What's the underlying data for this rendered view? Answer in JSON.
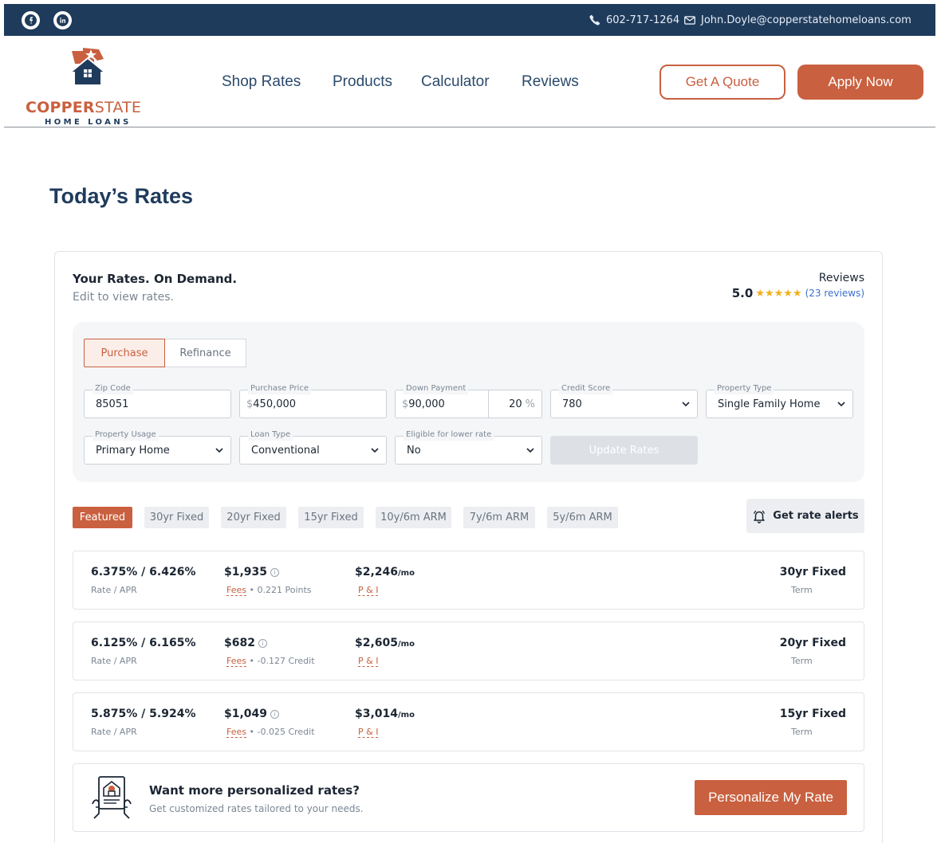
{
  "topbar": {
    "social": [
      {
        "icon": "facebook-icon"
      },
      {
        "icon": "linkedin-icon"
      }
    ],
    "phone": "602-717-1264",
    "email": "John.Doyle@copperstatehomeloans.com"
  },
  "logo": {
    "word_a": "COPPER",
    "word_b": "STATE",
    "sub": "HOME LOANS"
  },
  "nav": {
    "items": [
      "Shop Rates",
      "Products",
      "Calculator",
      "Reviews"
    ],
    "quote_label": "Get A Quote",
    "apply_label": "Apply Now"
  },
  "page": {
    "title": "Today’s Rates"
  },
  "card": {
    "title": "Your Rates. On Demand.",
    "subtitle": "Edit to view rates.",
    "reviews_label": "Reviews",
    "score": "5.0",
    "stars": "★★★★★",
    "reviews_link": "(23 reviews)"
  },
  "form": {
    "tabs": [
      "Purchase",
      "Refinance"
    ],
    "zip": {
      "label": "Zip Code",
      "value": "85051"
    },
    "price": {
      "label": "Purchase Price",
      "prefix": "$",
      "value": "450,000"
    },
    "down": {
      "label": "Down Payment",
      "prefix": "$",
      "value": "90,000",
      "pct": "20",
      "pct_sign": "%"
    },
    "credit": {
      "label": "Credit Score",
      "value": "780"
    },
    "property_type": {
      "label": "Property Type",
      "value": "Single Family Home"
    },
    "usage": {
      "label": "Property Usage",
      "value": "Primary Home"
    },
    "loan_type": {
      "label": "Loan Type",
      "value": "Conventional"
    },
    "eligible": {
      "label": "Eligible for lower rate",
      "value": "No"
    },
    "update_label": "Update Rates"
  },
  "filters": {
    "chips": [
      "Featured",
      "30yr Fixed",
      "20yr Fixed",
      "15yr Fixed",
      "10y/6m ARM",
      "7y/6m ARM",
      "5y/6m ARM"
    ],
    "alerts_label": "Get rate alerts"
  },
  "rates": [
    {
      "rate": "6.375% / 6.426%",
      "rate_label": "Rate / APR",
      "fee": "$1,935",
      "fees_link": "Fees",
      "fees_note": " • 0.221 Points",
      "payment": "$2,246",
      "per": "/mo",
      "pi": "P & I",
      "term": "30yr Fixed",
      "term_label": "Term"
    },
    {
      "rate": "6.125% / 6.165%",
      "rate_label": "Rate / APR",
      "fee": "$682",
      "fees_link": "Fees",
      "fees_note": " • -0.127 Credit",
      "payment": "$2,605",
      "per": "/mo",
      "pi": "P & I",
      "term": "20yr Fixed",
      "term_label": "Term"
    },
    {
      "rate": "5.875% / 5.924%",
      "rate_label": "Rate / APR",
      "fee": "$1,049",
      "fees_link": "Fees",
      "fees_note": " • -0.025 Credit",
      "payment": "$3,014",
      "per": "/mo",
      "pi": "P & I",
      "term": "15yr Fixed",
      "term_label": "Term"
    }
  ],
  "promo": {
    "title": "Want more personalized rates?",
    "subtitle": "Get customized rates tailored to your needs.",
    "button": "Personalize My Rate"
  },
  "colors": {
    "navy": "#1f3b5c",
    "copper": "#c9603f",
    "star": "#f2b01e",
    "link": "#3a6fd1"
  }
}
